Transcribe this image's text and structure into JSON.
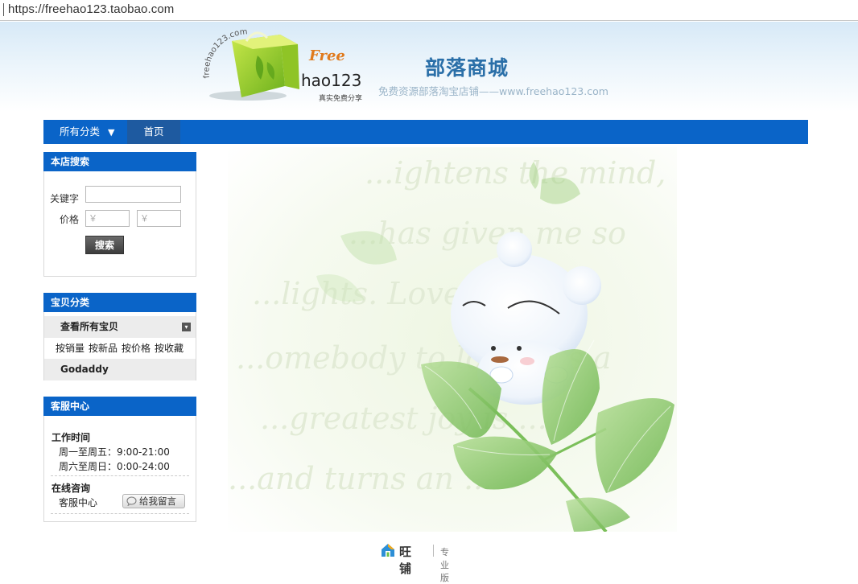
{
  "browser": {
    "url": "https://freehao123.taobao.com"
  },
  "header": {
    "logo": {
      "wordmark": "Free",
      "name": "hao123",
      "tagline": "真实免费分享",
      "arc_text": "freehao123.com"
    },
    "shop_name": "部落商城",
    "shop_slogan": "免费资源部落淘宝店铺——www.freehao123.com"
  },
  "nav": {
    "all_categories": "所有分类",
    "dropdown_icon": "triangle-down-icon",
    "home": "首页"
  },
  "search_panel": {
    "title": "本店搜索",
    "keyword_label": "关键字",
    "keyword_value": "",
    "price_label": "价格",
    "price_min_placeholder": "￥",
    "price_max_placeholder": "￥",
    "search_button": "搜索"
  },
  "category_panel": {
    "title": "宝贝分类",
    "view_all": "查看所有宝贝",
    "sorts": [
      "按销量",
      "按新品",
      "按价格",
      "按收藏"
    ],
    "categories": [
      "Godaddy"
    ]
  },
  "service_panel": {
    "title": "客服中心",
    "hours_heading": "工作时间",
    "weekday": "周一至周五：9:00-21:00",
    "weekend": "周六至周日：0:00-24:00",
    "online_heading": "在线咨询",
    "agent": "客服中心",
    "message_button": "给我留言"
  },
  "banner": {
    "script_lines": [
      "...ightens the mind,",
      "...has given me so",
      "...lights. Love ...",
      "...omebody to love ... s a",
      "...greatest joy is ...",
      "...and turns an ..."
    ]
  },
  "footer": {
    "brand": "旺铺",
    "edition": "专业版"
  },
  "colors": {
    "nav_blue": "#0a64c8",
    "nav_home": "#1e5aa0",
    "title_blue": "#2a6fa8",
    "leaf_green": "#8cc878"
  }
}
